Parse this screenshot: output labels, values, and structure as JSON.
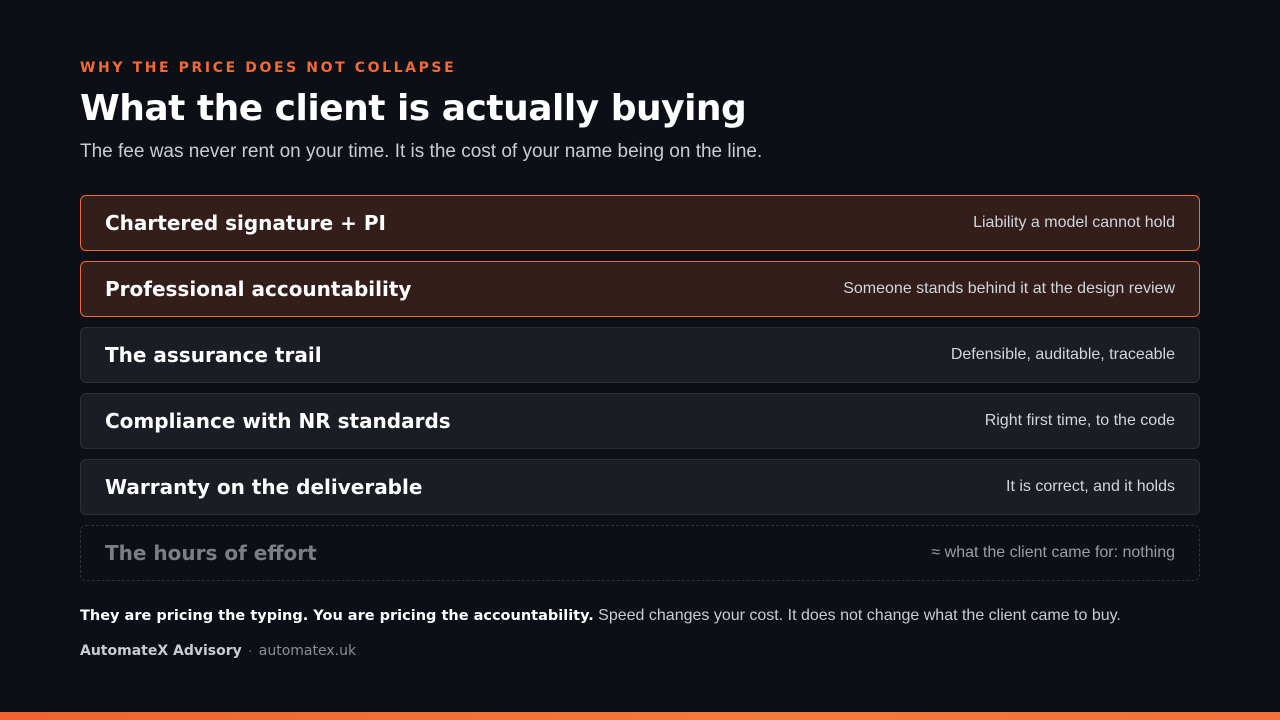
{
  "header": {
    "eyebrow": "WHY THE PRICE DOES NOT COLLAPSE",
    "title": "What the client is actually buying",
    "subtitle": "The fee was never rent on your time. It is the cost of your name being on the line."
  },
  "rows": [
    {
      "label": "Chartered signature + PI",
      "note": "Liability a model cannot hold",
      "style": "highlight"
    },
    {
      "label": "Professional accountability",
      "note": "Someone stands behind it at the design review",
      "style": "highlight"
    },
    {
      "label": "The assurance trail",
      "note": "Defensible, auditable, traceable",
      "style": "normal"
    },
    {
      "label": "Compliance with NR standards",
      "note": "Right first time, to the code",
      "style": "normal"
    },
    {
      "label": "Warranty on the deliverable",
      "note": "It is correct, and it holds",
      "style": "normal"
    },
    {
      "label": "The hours of effort",
      "note": "≈ what the client came for: nothing",
      "style": "muted"
    }
  ],
  "summary": {
    "bold": "They are pricing the typing. You are pricing the accountability.",
    "rest": " Speed changes your cost. It does not change what the client came to buy."
  },
  "footer": {
    "brand": "AutomateX Advisory",
    "separator": "·",
    "site": "automatex.uk"
  },
  "colors": {
    "background": "#0c0f16",
    "accent": "#f26b36",
    "highlight_fill": "#331e1c",
    "row_fill": "#1a1d23"
  }
}
